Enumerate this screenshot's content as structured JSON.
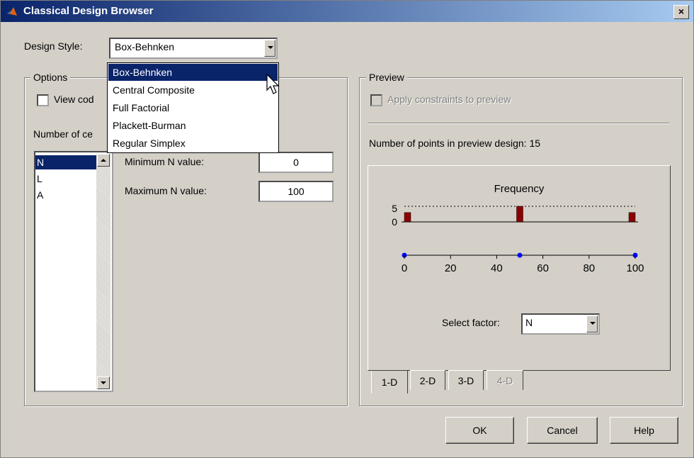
{
  "window": {
    "title": "Classical Design Browser",
    "close_glyph": "×"
  },
  "design_style": {
    "label": "Design Style:",
    "value": "Box-Behnken",
    "options": [
      "Box-Behnken",
      "Central Composite",
      "Full Factorial",
      "Plackett-Burman",
      "Regular Simplex"
    ]
  },
  "options_group": {
    "title": "Options",
    "view_coded_label": "View cod",
    "number_label": "Number of ce",
    "factors": [
      "N",
      "L",
      "A"
    ],
    "min_label": "Minimum N value:",
    "min_value": "0",
    "max_label": "Maximum N value:",
    "max_value": "100"
  },
  "preview_group": {
    "title": "Preview",
    "apply_constraints_label": "Apply constraints to preview",
    "points_text": "Number of points in preview design: 15",
    "select_factor_label": "Select factor:",
    "select_factor_value": "N",
    "tabs": [
      "1-D",
      "2-D",
      "3-D",
      "4-D"
    ]
  },
  "chart_data": {
    "type": "bar",
    "title": "Frequency",
    "freq_ticks": [
      "5",
      "0"
    ],
    "bars": [
      {
        "x": 0,
        "value": 3
      },
      {
        "x": 50,
        "value": 5
      },
      {
        "x": 100,
        "value": 3
      }
    ],
    "points": [
      0,
      50,
      100
    ],
    "xticks": [
      0,
      20,
      40,
      60,
      80,
      100
    ],
    "xlim": [
      0,
      100
    ],
    "ylim": [
      0,
      5
    ],
    "colors": {
      "bar": "#8b0000",
      "point": "#0000ff"
    }
  },
  "buttons": {
    "ok": "OK",
    "cancel": "Cancel",
    "help": "Help"
  }
}
